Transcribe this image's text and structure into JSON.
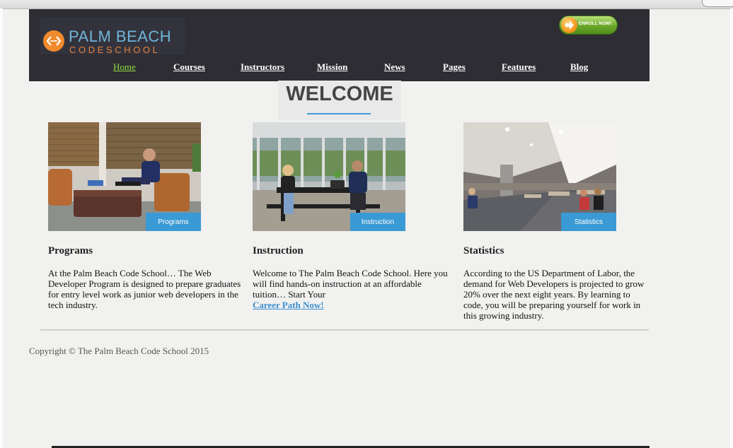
{
  "header": {
    "logo": {
      "line1": "PALM BEACH",
      "line2": "CODESCHOOL"
    },
    "enroll_label": "ENROLL NOW!",
    "nav": [
      "Home",
      "Courses",
      "Instructors",
      "Mission",
      "News",
      "Pages",
      "Features",
      "Blog"
    ],
    "active_nav": "Home"
  },
  "welcome": {
    "title": "WELCOME"
  },
  "cards": [
    {
      "tag": "Programs",
      "title": "Programs",
      "body": "At the Palm Beach Code School… The Web Developer Program is designed to prepare graduates for entry level work as junior web developers in the tech industry.",
      "link": ""
    },
    {
      "tag": "Instruction",
      "title": "Instruction",
      "body": "Welcome to The Palm Beach Code School. Here you will find hands-on instruction at an affordable tuition… Start Your",
      "link": "Career Path Now!"
    },
    {
      "tag": "Statistics",
      "title": "Statistics",
      "body": "According to the US Department of Labor, the demand for Web Developers is projected to grow 20% over the next eight years. By learning to code, you will be preparing yourself for work in this growing industry.",
      "link": ""
    }
  ],
  "footer": {
    "copyright": "Copyright © The Palm Beach Code School 2015"
  },
  "colors": {
    "header_bg": "#2d2d33",
    "accent_blue": "#3a9ad5",
    "nav_active": "#8fdc45",
    "logo_blue": "#6fb6d9",
    "logo_orange": "#e8833a",
    "enroll_green": "#6aa82a"
  },
  "icons": {
    "logo": "code-brackets-icon",
    "enroll": "arrow-right-icon"
  }
}
